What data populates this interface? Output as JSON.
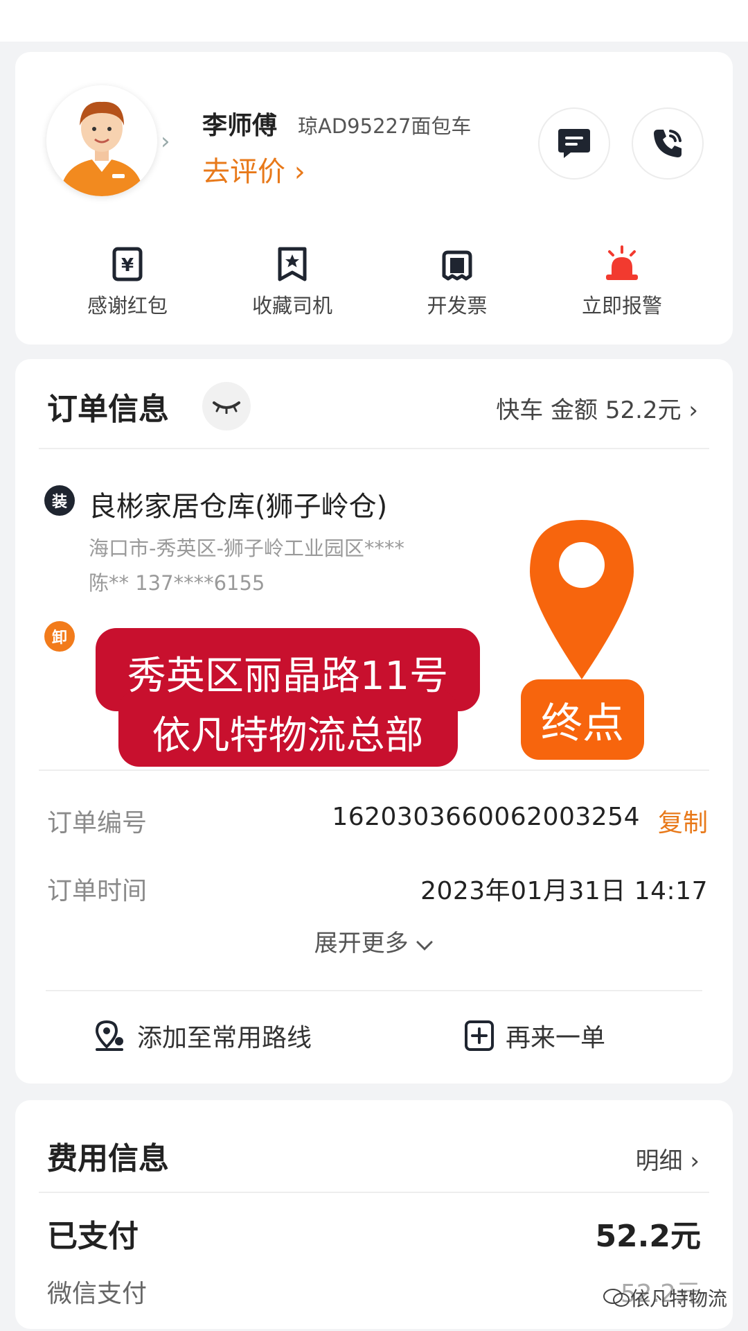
{
  "driver": {
    "name": "李师傅",
    "plate": "琼AD95227面包车",
    "rate_label": "去评价",
    "actions": [
      {
        "label": "感谢红包",
        "icon": "yen-envelope-icon"
      },
      {
        "label": "收藏司机",
        "icon": "star-bookmark-icon"
      },
      {
        "label": "开发票",
        "icon": "invoice-icon"
      },
      {
        "label": "立即报警",
        "icon": "alarm-siren-icon"
      }
    ]
  },
  "order": {
    "title": "订单信息",
    "meta": "快车 金额 52.2元",
    "pickup": {
      "badge": "装",
      "name": "良彬家居仓库(狮子岭仓)",
      "address": "海口市-秀英区-狮子岭工业园区****",
      "contact": "陈** 137****6155"
    },
    "dropoff": {
      "badge": "卸"
    },
    "number_label": "订单编号",
    "number_value": "1620303660062003254",
    "copy_label": "复制",
    "time_label": "订单时间",
    "time_value": "2023年01月31日 14:17",
    "expand_label": "展开更多",
    "add_route_label": "添加至常用路线",
    "reorder_label": "再来一单"
  },
  "overlay": {
    "line1": "秀英区丽晶路11号",
    "line2": "依凡特物流总部",
    "end_label": "终点"
  },
  "fee": {
    "title": "费用信息",
    "detail_label": "明细",
    "paid_label": "已支付",
    "paid_value": "52.2元",
    "wechat_label": "微信支付",
    "wechat_value": "52.2元"
  },
  "watermark": "依凡特物流",
  "colors": {
    "accent": "#e8791a",
    "red_sticker": "#c8102e",
    "pin_orange": "#f7650d",
    "alarm_red": "#f23a2f"
  }
}
